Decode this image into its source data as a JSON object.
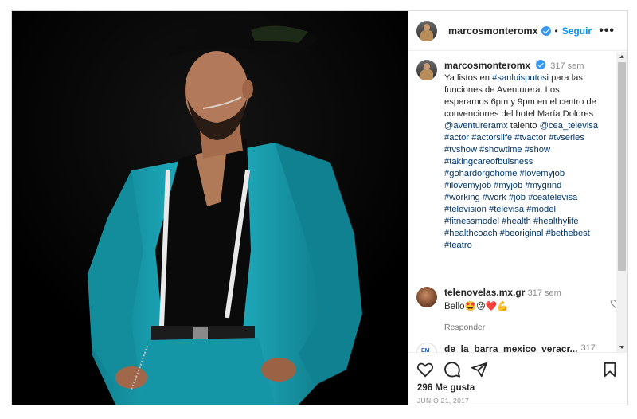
{
  "post": {
    "username": "marcosmonteromx",
    "separator": "•",
    "follow_label": "Seguir",
    "more_label": "•••",
    "caption": {
      "username": "marcosmonteromx",
      "time": "317 sem",
      "lines": [
        [
          {
            "t": "Ya listos en ",
            "tag": false
          },
          {
            "t": "#sanluispotosi",
            "tag": true
          },
          {
            "t": " para las",
            "tag": false
          }
        ],
        [
          {
            "t": "funciones de Aventurera. Los",
            "tag": false
          }
        ],
        [
          {
            "t": "esperamos 6pm y 9pm en el centro de",
            "tag": false
          }
        ],
        [
          {
            "t": "convenciones del hotel María Dolores",
            "tag": false
          }
        ],
        [
          {
            "t": "@aventureramx",
            "tag": true
          },
          {
            "t": " talento ",
            "tag": false
          },
          {
            "t": "@cea_televisa",
            "tag": true
          }
        ],
        [
          {
            "t": "#actor #actorslife #tvactor #tvseries",
            "tag": true
          }
        ],
        [
          {
            "t": "#tvshow #showtime #show",
            "tag": true
          }
        ],
        [
          {
            "t": "#takingcareofbuisness",
            "tag": true
          }
        ],
        [
          {
            "t": "#gohardorgohome #lovemyjob",
            "tag": true
          }
        ],
        [
          {
            "t": "#ilovemyjob #myjob #mygrind",
            "tag": true
          }
        ],
        [
          {
            "t": "#working #work #job #ceatelevisa",
            "tag": true
          }
        ],
        [
          {
            "t": "#television #televisa #model",
            "tag": true
          }
        ],
        [
          {
            "t": "#fitnessmodel #health #healthylife",
            "tag": true
          }
        ],
        [
          {
            "t": "#healthcoach #beoriginal #bethebest",
            "tag": true
          }
        ],
        [
          {
            "t": "#teatro",
            "tag": true
          }
        ]
      ]
    },
    "comments": [
      {
        "username": "telenovelas.mx.gr",
        "time": "317 sem",
        "text": "Bello🤩😘❤️💪",
        "reply_label": "Responder"
      },
      {
        "username": "de_la_barra_mexico_veracr...",
        "time": "317",
        "avatar_text": "EM"
      }
    ],
    "likes": "296 Me gusta",
    "date": "JUNIO 21, 2017",
    "colors": {
      "link": "#00376b",
      "accent": "#0095f6",
      "verified": "#3897f0",
      "suit": "#1aa6b7"
    }
  }
}
